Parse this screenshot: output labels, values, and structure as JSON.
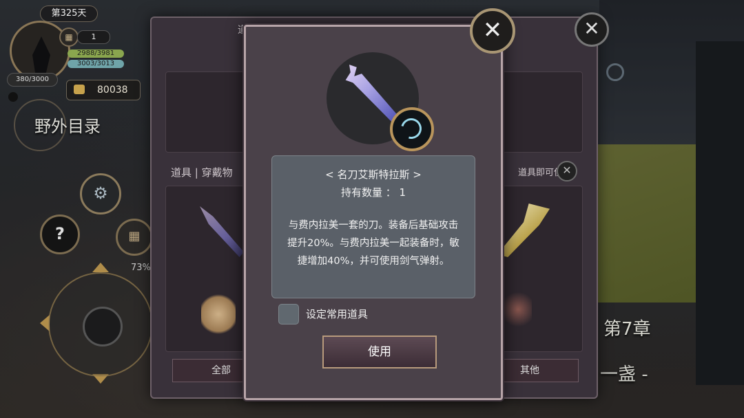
{
  "hud": {
    "day": "第325天",
    "counter": "1",
    "hp": "2988/3981",
    "mp": "3003/3013",
    "exp": "380/3000",
    "gold": "80038",
    "field_title": "野外目录",
    "percent": "73%"
  },
  "background": {
    "chapter": "第7章",
    "chapter_subtitle": "... 一盏 -"
  },
  "storage_panel": {
    "title": "道具保管箱",
    "tab_left": "道具 | 穿戴物",
    "tab_right": "道具即可使用",
    "bottom_tabs": [
      "全部",
      "其他"
    ]
  },
  "item_dialog": {
    "item_name": "< 名刀艾斯特拉斯 >",
    "quantity_label": "持有数量 ： 1",
    "description": "与费内拉美一套的刀。装备后基础攻击提升20%。与费内拉美一起装备时，敏捷增加40%，并可使用剑气弹射。",
    "checkbox_label": "设定常用道具",
    "use_button": "使用"
  },
  "colors": {
    "dialog_bg": "#4a4149",
    "dialog_border": "#b7a4a8",
    "desc_bg": "#5a6068",
    "gold_accent": "#b9955c"
  },
  "icons": {
    "close": "close-icon",
    "gear": "gear-icon",
    "help": "help-icon",
    "calendar": "calendar-icon",
    "gold": "gold-coin-icon",
    "skill": "sword-skill-icon"
  }
}
